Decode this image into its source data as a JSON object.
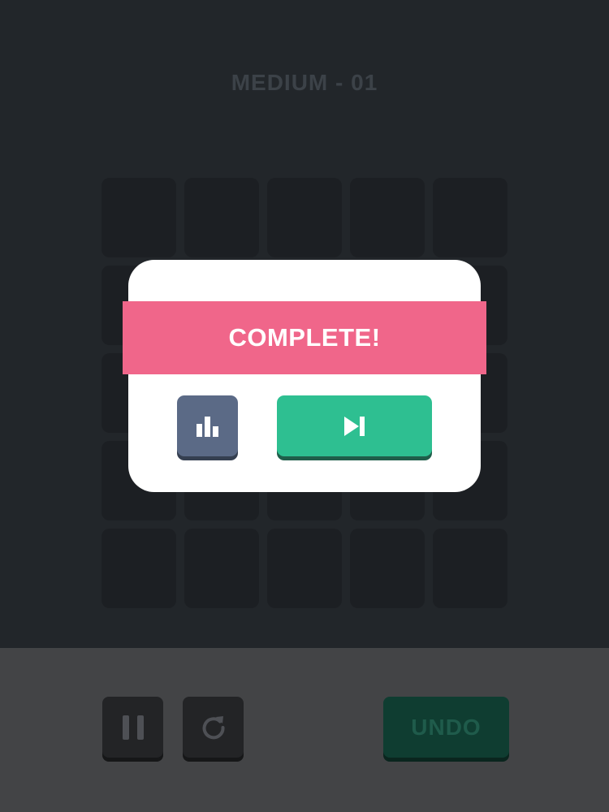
{
  "header": {
    "level_title": "MEDIUM - 01"
  },
  "board": {
    "rows": 5,
    "cols": 5
  },
  "toolbar": {
    "pause_icon": "pause-icon",
    "restart_icon": "restart-icon",
    "undo_label": "UNDO"
  },
  "dialog": {
    "banner_text": "COMPLETE!",
    "stats_icon": "bar-chart-icon",
    "next_icon": "skip-next-icon"
  },
  "colors": {
    "banner": "#f0668a",
    "next_button": "#2ebf91",
    "stats_button": "#5b6a86",
    "undo_button": "#0f3d31",
    "background": "#22262a"
  }
}
